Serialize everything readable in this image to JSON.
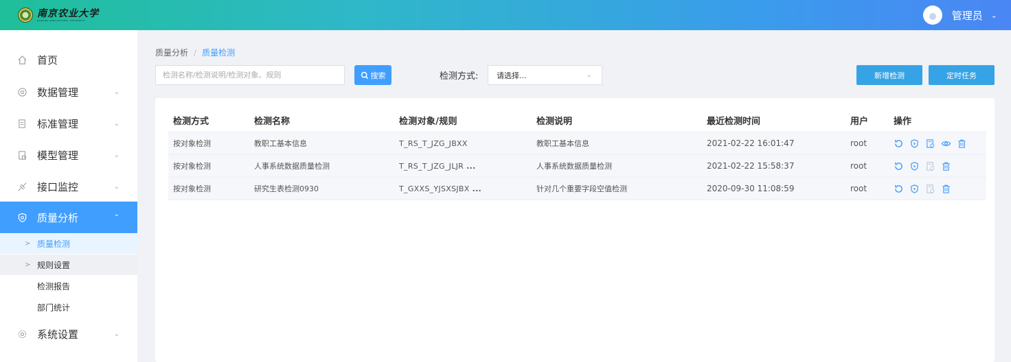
{
  "header": {
    "logo_cn": "南京农业大学",
    "logo_en": "NANJING AGRICULTURAL UNIVERSITY",
    "user_name": "管理员"
  },
  "sidebar": {
    "items": [
      {
        "label": "首页",
        "icon": "home-icon"
      },
      {
        "label": "数据管理",
        "icon": "dataset-icon"
      },
      {
        "label": "标准管理",
        "icon": "standard-icon"
      },
      {
        "label": "模型管理",
        "icon": "model-icon"
      },
      {
        "label": "接口监控",
        "icon": "monitor-icon"
      },
      {
        "label": "质量分析",
        "icon": "shield-icon"
      },
      {
        "label": "系统设置",
        "icon": "gear-icon"
      }
    ],
    "sub_items": [
      "质量检测",
      "规则设置",
      "检测报告",
      "部门统计"
    ]
  },
  "breadcrumb": {
    "parent": "质量分析",
    "current": "质量检测"
  },
  "toolbar": {
    "search_placeholder": "检测名称/检测说明/检测对象、规则",
    "search_label": "搜索",
    "method_label": "检测方式:",
    "method_placeholder": "请选择...",
    "new_label": "新增检测",
    "cron_label": "定时任务"
  },
  "table": {
    "columns": [
      "检测方式",
      "检测名称",
      "检测对象/规则",
      "检测说明",
      "最近检测时间",
      "用户",
      "操作"
    ],
    "rows": [
      {
        "method": "按对象检测",
        "name": "教职工基本信息",
        "target": "T_RS_T_JZG_JBXX",
        "more": "",
        "desc": "教职工基本信息",
        "time": "2021-02-22 16:01:47",
        "user": "root"
      },
      {
        "method": "按对象检测",
        "name": "人事系统数据质量检测",
        "target": "T_RS_T_JZG_JLJR",
        "more": "...",
        "desc": "人事系统数据质量检测",
        "time": "2021-02-22 15:58:37",
        "user": "root"
      },
      {
        "method": "按对象检测",
        "name": "研究生表检测0930",
        "target": "T_GXXS_YJSXSJBX",
        "more": "...",
        "desc": "针对几个重要字段空值检测",
        "time": "2020-09-30 11:08:59",
        "user": "root"
      }
    ]
  },
  "colors": {
    "primary": "#409eff",
    "button": "#36a3e6",
    "header_start": "#1fbf9a",
    "header_end": "#4a86f4"
  }
}
